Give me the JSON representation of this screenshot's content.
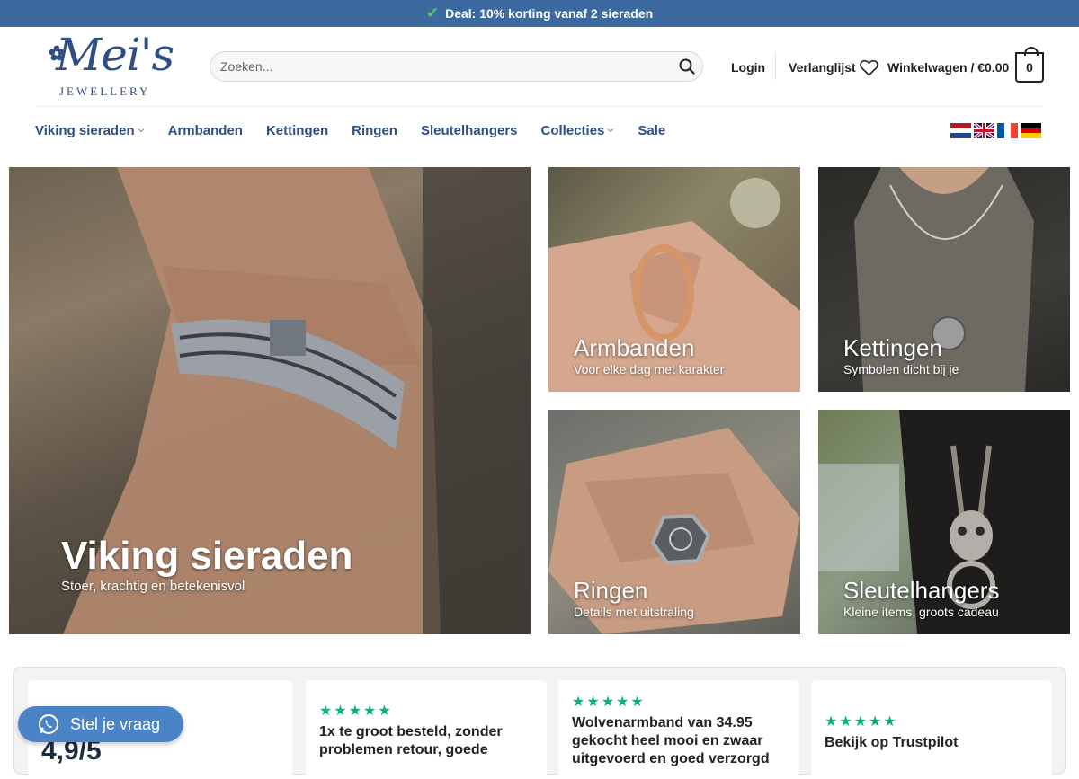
{
  "topbar": {
    "deal": "Deal: 10% korting vanaf 2 sieraden"
  },
  "logo": {
    "script": "Mei's",
    "sub": "JEWELLERY"
  },
  "search": {
    "placeholder": "Zoeken..."
  },
  "header": {
    "login": "Login",
    "wishlist": "Verlanglijst",
    "cart": "Winkelwagen / €0.00",
    "cart_count": "0"
  },
  "menu": [
    "Viking sieraden",
    "Armbanden",
    "Kettingen",
    "Ringen",
    "Sleutelhangers",
    "Collecties",
    "Sale"
  ],
  "tiles": {
    "viking": {
      "title": "Viking sieraden",
      "subtitle": "Stoer, krachtig en betekenisvol"
    },
    "armbanden": {
      "title": "Armbanden",
      "subtitle": "Voor elke dag met karakter"
    },
    "kettingen": {
      "title": "Kettingen",
      "subtitle": "Symbolen dicht bij je"
    },
    "ringen": {
      "title": "Ringen",
      "subtitle": "Details met uitstraling"
    },
    "sleutelhangers": {
      "title": "Sleutelhangers",
      "subtitle": "Kleine items, groots cadeau"
    }
  },
  "reviews": {
    "rating": "4,9/5",
    "stars": "★★★★★",
    "r1": "1x te groot besteld, zonder problemen retour, goede",
    "r2": "Wolvenarmband van 34.95 gekocht heel mooi en zwaar uitgevoerd en goed verzorgd",
    "r3": "Bekijk op Trustpilot"
  },
  "chat": {
    "label": "Stel je vraag"
  },
  "colors": {
    "brand_blue": "#2d4f86",
    "topbar": "#3c6aa0",
    "trustpilot_green": "#00b67a",
    "chat": "#4a84c6"
  }
}
